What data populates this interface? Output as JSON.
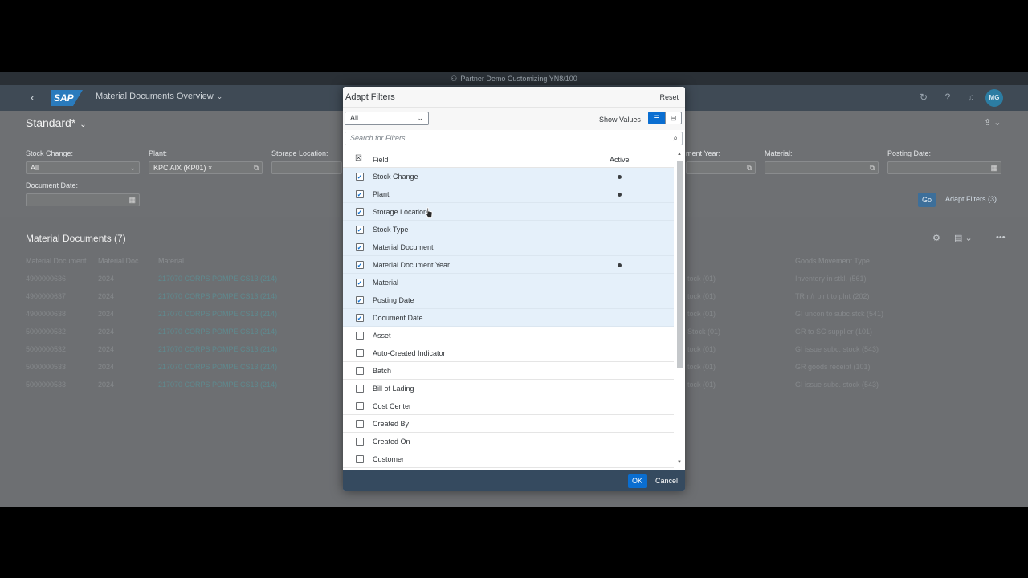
{
  "system_banner": "Partner Demo Customizing YN8/100",
  "shell": {
    "title": "Material Documents Overview",
    "avatar": "MG"
  },
  "filterbar": {
    "variant": "Standard*",
    "labels": {
      "stock_change": "Stock Change:",
      "plant": "Plant:",
      "storage_location": "Storage Location:",
      "material_doc_year": "ment Year:",
      "material": "Material:",
      "posting_date": "Posting Date:",
      "document_date": "Document Date:"
    },
    "values": {
      "stock_change": "All",
      "plant": "KPC AIX (KP01)"
    },
    "go": "Go",
    "adapt_filters": "Adapt Filters (3)"
  },
  "table": {
    "title": "Material Documents (7)",
    "columns": [
      "Material Document",
      "Material Doc",
      "Material",
      "Goods Movement Type"
    ],
    "rows": [
      {
        "doc": "4900000636",
        "year": "2024",
        "material": "217070 CORPS POMPE CS13 (214)",
        "stock": "tock (01)",
        "gmt": "Inventory in stkl. (561)"
      },
      {
        "doc": "4900000637",
        "year": "2024",
        "material": "217070 CORPS POMPE CS13 (214)",
        "stock": "tock (01)",
        "gmt": "TR n/r plnt to plnt (202)"
      },
      {
        "doc": "4900000638",
        "year": "2024",
        "material": "217070 CORPS POMPE CS13 (214)",
        "stock": "tock (01)",
        "gmt": "GI uncon to subc.stck (541)"
      },
      {
        "doc": "5000000532",
        "year": "2024",
        "material": "217070 CORPS POMPE CS13 (214)",
        "stock": "Stock (01)",
        "gmt": "GR to SC supplier (101)"
      },
      {
        "doc": "5000000532",
        "year": "2024",
        "material": "217070 CORPS POMPE CS13 (214)",
        "stock": "tock (01)",
        "gmt": "GI issue subc. stock (543)"
      },
      {
        "doc": "5000000533",
        "year": "2024",
        "material": "217070 CORPS POMPE CS13 (214)",
        "stock": "tock (01)",
        "gmt": "GR goods receipt (101)"
      },
      {
        "doc": "5000000533",
        "year": "2024",
        "material": "217070 CORPS POMPE CS13 (214)",
        "stock": "tock (01)",
        "gmt": "GI issue subc. stock (543)"
      }
    ]
  },
  "dialog": {
    "title": "Adapt Filters",
    "reset": "Reset",
    "select_value": "All",
    "show_values": "Show Values",
    "search_placeholder": "Search for Filters",
    "col_field": "Field",
    "col_active": "Active",
    "items": [
      {
        "label": "Stock Change",
        "checked": true,
        "active": true
      },
      {
        "label": "Plant",
        "checked": true,
        "active": true
      },
      {
        "label": "Storage Location",
        "checked": true,
        "active": false
      },
      {
        "label": "Stock Type",
        "checked": true,
        "active": false
      },
      {
        "label": "Material Document",
        "checked": true,
        "active": false
      },
      {
        "label": "Material Document Year",
        "checked": true,
        "active": true
      },
      {
        "label": "Material",
        "checked": true,
        "active": false
      },
      {
        "label": "Posting Date",
        "checked": true,
        "active": false
      },
      {
        "label": "Document Date",
        "checked": true,
        "active": false
      },
      {
        "label": "Asset",
        "checked": false,
        "active": false
      },
      {
        "label": "Auto-Created Indicator",
        "checked": false,
        "active": false
      },
      {
        "label": "Batch",
        "checked": false,
        "active": false
      },
      {
        "label": "Bill of Lading",
        "checked": false,
        "active": false
      },
      {
        "label": "Cost Center",
        "checked": false,
        "active": false
      },
      {
        "label": "Created By",
        "checked": false,
        "active": false
      },
      {
        "label": "Created On",
        "checked": false,
        "active": false
      },
      {
        "label": "Customer",
        "checked": false,
        "active": false
      }
    ],
    "ok": "OK",
    "cancel": "Cancel"
  },
  "colors": {
    "accent": "#0a6ed1",
    "shell": "#354a5f",
    "selected_row": "#e5f0fa"
  }
}
